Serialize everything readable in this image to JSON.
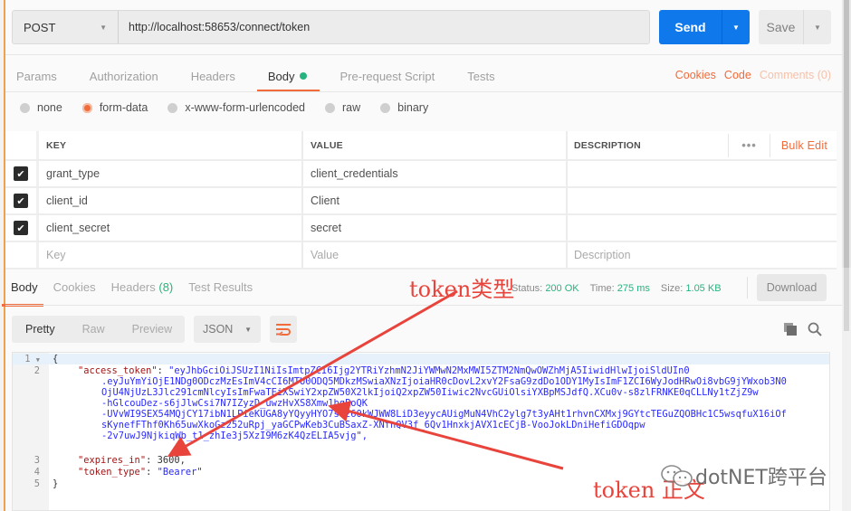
{
  "request": {
    "method": "POST",
    "url": "http://localhost:58653/connect/token",
    "send_label": "Send",
    "save_label": "Save"
  },
  "request_tabs": [
    {
      "label": "Params",
      "active": false
    },
    {
      "label": "Authorization",
      "active": false
    },
    {
      "label": "Headers",
      "active": false
    },
    {
      "label": "Body",
      "active": true,
      "indicator": true
    },
    {
      "label": "Pre-request Script",
      "active": false
    },
    {
      "label": "Tests",
      "active": false
    }
  ],
  "request_links": {
    "cookies": "Cookies",
    "code": "Code",
    "comments": "Comments (0)"
  },
  "body_types": [
    {
      "label": "none",
      "selected": false
    },
    {
      "label": "form-data",
      "selected": true
    },
    {
      "label": "x-www-form-urlencoded",
      "selected": false
    },
    {
      "label": "raw",
      "selected": false
    },
    {
      "label": "binary",
      "selected": false
    }
  ],
  "params_table": {
    "columns": {
      "key": "KEY",
      "value": "VALUE",
      "description": "DESCRIPTION"
    },
    "more_label": "•••",
    "bulk_edit": "Bulk Edit",
    "rows": [
      {
        "checked": true,
        "key": "grant_type",
        "value": "client_credentials",
        "description": ""
      },
      {
        "checked": true,
        "key": "client_id",
        "value": "Client",
        "description": ""
      },
      {
        "checked": true,
        "key": "client_secret",
        "value": "secret",
        "description": ""
      }
    ],
    "placeholders": {
      "key": "Key",
      "value": "Value",
      "description": "Description"
    }
  },
  "response_tabs": [
    {
      "label": "Body",
      "active": true
    },
    {
      "label": "Cookies",
      "active": false
    },
    {
      "label": "Headers",
      "count": "(8)",
      "active": false
    },
    {
      "label": "Test Results",
      "active": false
    }
  ],
  "response_meta": {
    "status_label": "Status:",
    "status": "200 OK",
    "time_label": "Time:",
    "time": "275 ms",
    "size_label": "Size:",
    "size": "1.05 KB",
    "download_label": "Download"
  },
  "view": {
    "modes": [
      "Pretty",
      "Raw",
      "Preview"
    ],
    "active_mode": "Pretty",
    "format": "JSON"
  },
  "response_body": {
    "line_numbers": [
      "1",
      "2",
      "",
      "",
      "",
      "",
      "",
      "",
      "",
      "3",
      "4",
      "5"
    ],
    "access_token_key": "\"access_token\"",
    "access_token_lines": [
      "\"eyJhbGciOiJSUzI1NiIsImtpZCI6Ijg2YTRiYzhmN2JiYWMwN2MxMWI5ZTM2NmQwOWZhMjA5IiwidHlwIjoiSldUIn0",
      ".eyJuYmYiOjE1NDg0ODczMzEsImV4cCI6MTU0ODQ5MDkzMSwiaXNzIjoiaHR0cDovL2xvY2FsaG9zdDo1ODY1MyIsImF1ZCI6WyJodHRwOi8vbG9jYWxob3N0",
      "OjU4NjUzL3Jlc291cmNlcyIsImFwaTEiXSwiY2xpZW50X2lkIjoiQ2xpZW50Iiwic2NvcGUiOlsiYXBpMSJdfQ.XCu0v-s8zlFRNKE0qCLLNy1tZjZ9w",
      "-hGlcouDez-s6jJlwCsi7N7IZyzD_uwzHvXS8Xmw1bqPoQK",
      "-UVvWI9SEX54MQjCY17ibN1LPieKUGA8yYQyyHYO7sVz60kWJWW8LiD3eyycAUigMuN4VhC2ylg7t3yAHt1rhvnCXMxj9GYtcTEGuZQOBHc1C5wsqfuX16iOf",
      "sKynefFThf0Kh65uwXkoGz252uRpj_yaGCPwKeb3CuBSaxZ-XNfnQV3f_6Qv1HnxkjAVX1cECjB-VooJokLDniHefiGDOqpw",
      "-2v7uwJ9NjkiqWb_t1_zhIe3j5XzI9M6zK4QzELIA5vjg\","
    ],
    "expires_in_key": "\"expires_in\"",
    "expires_in_value": "3600",
    "token_type_key": "\"token_type\"",
    "token_type_value": "\"Bearer\""
  },
  "annotations": {
    "token_type_label": "token类型",
    "token_body_label": "token 正文",
    "watermark": "dotNET跨平台",
    "color": "#e8443c"
  }
}
